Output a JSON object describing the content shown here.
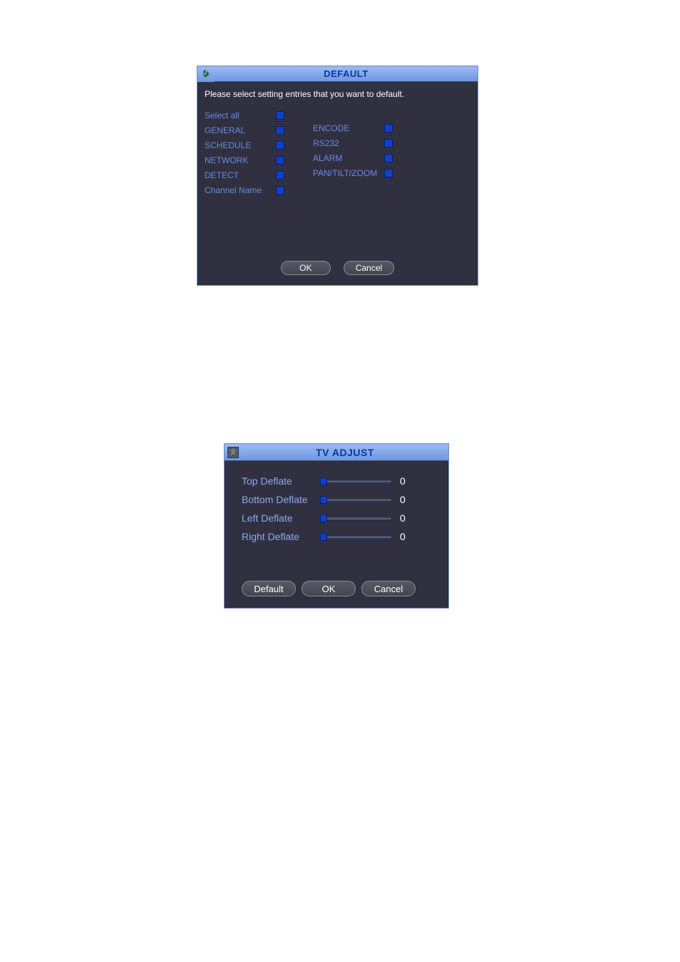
{
  "dialog1": {
    "title": "DEFAULT",
    "instruction": "Please select setting entries that you want to default.",
    "col1": [
      {
        "label": "Select all"
      },
      {
        "label": "GENERAL"
      },
      {
        "label": "SCHEDULE"
      },
      {
        "label": "NETWORK"
      },
      {
        "label": "DETECT"
      },
      {
        "label": "Channel Name"
      }
    ],
    "col2": [
      {
        "label": "ENCODE"
      },
      {
        "label": "RS232"
      },
      {
        "label": "ALARM"
      },
      {
        "label": "PAN/TILT/ZOOM"
      }
    ],
    "buttons": {
      "ok": "OK",
      "cancel": "Cancel"
    }
  },
  "dialog2": {
    "title": "TV ADJUST",
    "sliders": [
      {
        "label": "Top Deflate",
        "value": "0"
      },
      {
        "label": "Bottom Deflate",
        "value": "0"
      },
      {
        "label": "Left Deflate",
        "value": "0"
      },
      {
        "label": "Right Deflate",
        "value": "0"
      }
    ],
    "buttons": {
      "default": "Default",
      "ok": "OK",
      "cancel": "Cancel"
    }
  }
}
